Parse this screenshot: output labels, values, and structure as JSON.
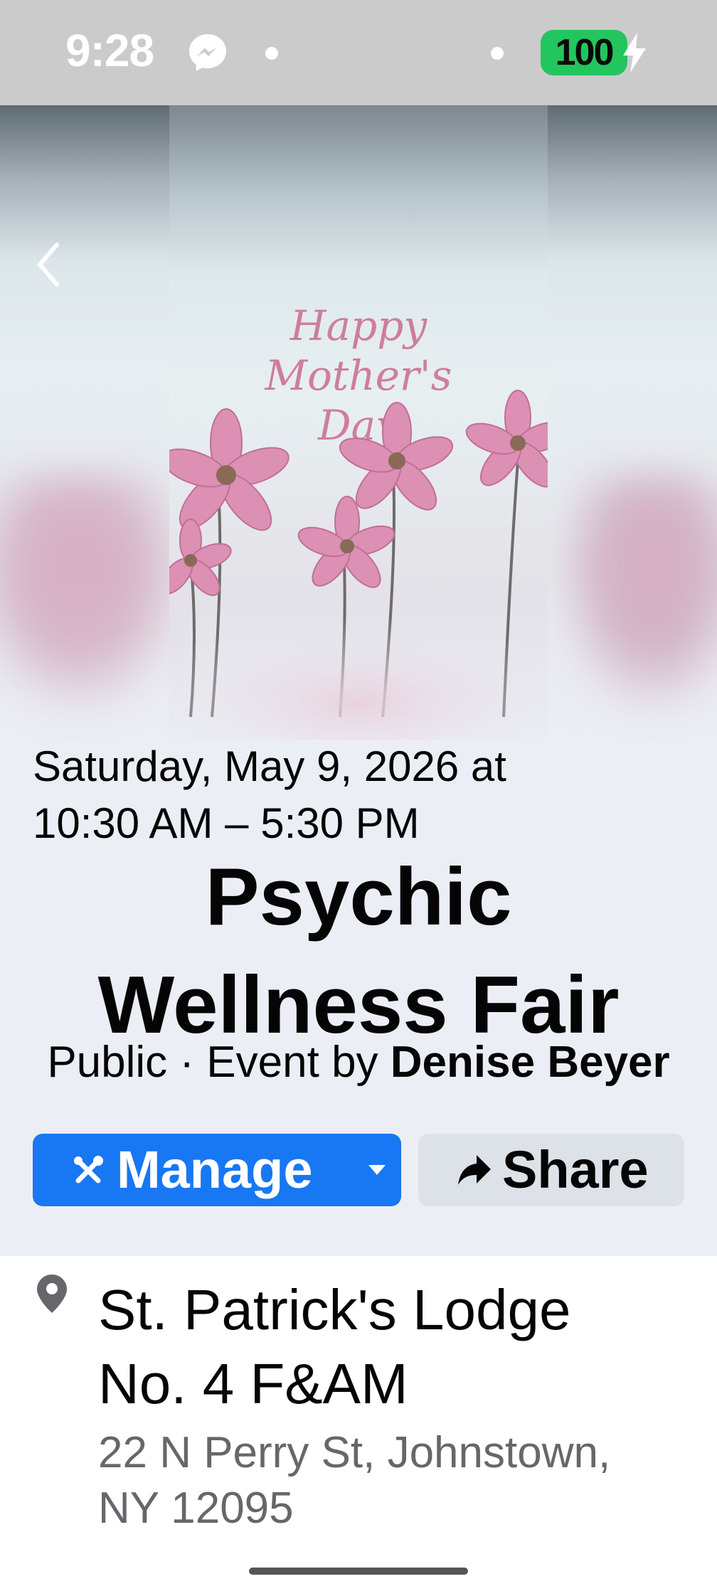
{
  "status_bar": {
    "time": "9:28",
    "battery_level": "100",
    "colors": {
      "battery_fill": "#22c55e",
      "background": "#cbcbcb"
    },
    "icons": [
      "messenger-icon",
      "notification-dot",
      "charging-bolt-icon"
    ]
  },
  "hero": {
    "poster_text": "Happy Mother's Day",
    "back_icon": "chevron-left-icon"
  },
  "event": {
    "date_time": "Saturday, May 9, 2026 at\n10:30 AM – 5:30 PM",
    "title": "Psychic\nWellness Fair",
    "privacy": "Public",
    "separator": " · ",
    "host_prefix": "Event by ",
    "host_name": "Denise Beyer"
  },
  "actions": {
    "manage_label": "Manage",
    "share_label": "Share",
    "colors": {
      "manage_bg": "#1877f2",
      "share_bg": "#dde1e8"
    }
  },
  "location": {
    "venue": "St. Patrick's Lodge\nNo. 4 F&AM",
    "address": "22 N Perry St, Johnstown,\nNY 12095"
  }
}
